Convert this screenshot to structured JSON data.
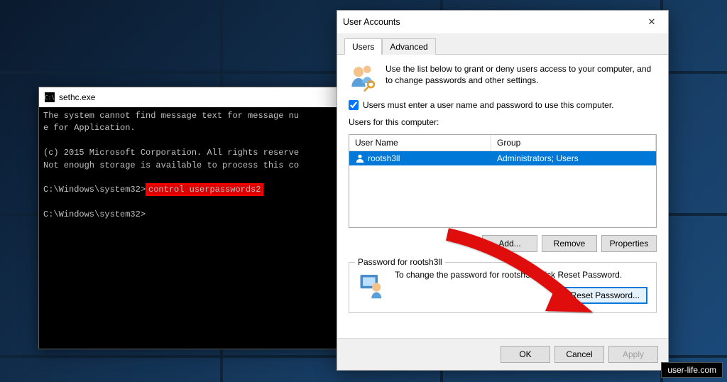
{
  "cmd": {
    "title": "sethc.exe",
    "line1": "The system cannot find message text for message nu",
    "line2": "e for Application.",
    "line3": "(c) 2015 Microsoft Corporation. All rights reserve",
    "line4": "Not enough storage is available to process this co",
    "prompt1": "C:\\Windows\\system32>",
    "command_highlight": "control userpasswords2",
    "prompt2": "C:\\Windows\\system32>"
  },
  "dialog": {
    "title": "User Accounts",
    "tabs": [
      "Users",
      "Advanced"
    ],
    "intro": "Use the list below to grant or deny users access to your computer, and to change passwords and other settings.",
    "checkbox_label": "Users must enter a user name and password to use this computer.",
    "checkbox_checked": true,
    "users_label": "Users for this computer:",
    "list_headers": {
      "c1": "User Name",
      "c2": "Group"
    },
    "list_row": {
      "username": "rootsh3ll",
      "group": "Administrators; Users"
    },
    "buttons": {
      "add": "Add...",
      "remove": "Remove",
      "props": "Properties"
    },
    "group_title": "Password for rootsh3ll",
    "password_text": "To change the password for rootsh3ll, click Reset Password.",
    "reset_btn": "Reset Password...",
    "footer": {
      "ok": "OK",
      "cancel": "Cancel",
      "apply": "Apply"
    }
  },
  "watermark": "user-life.com"
}
